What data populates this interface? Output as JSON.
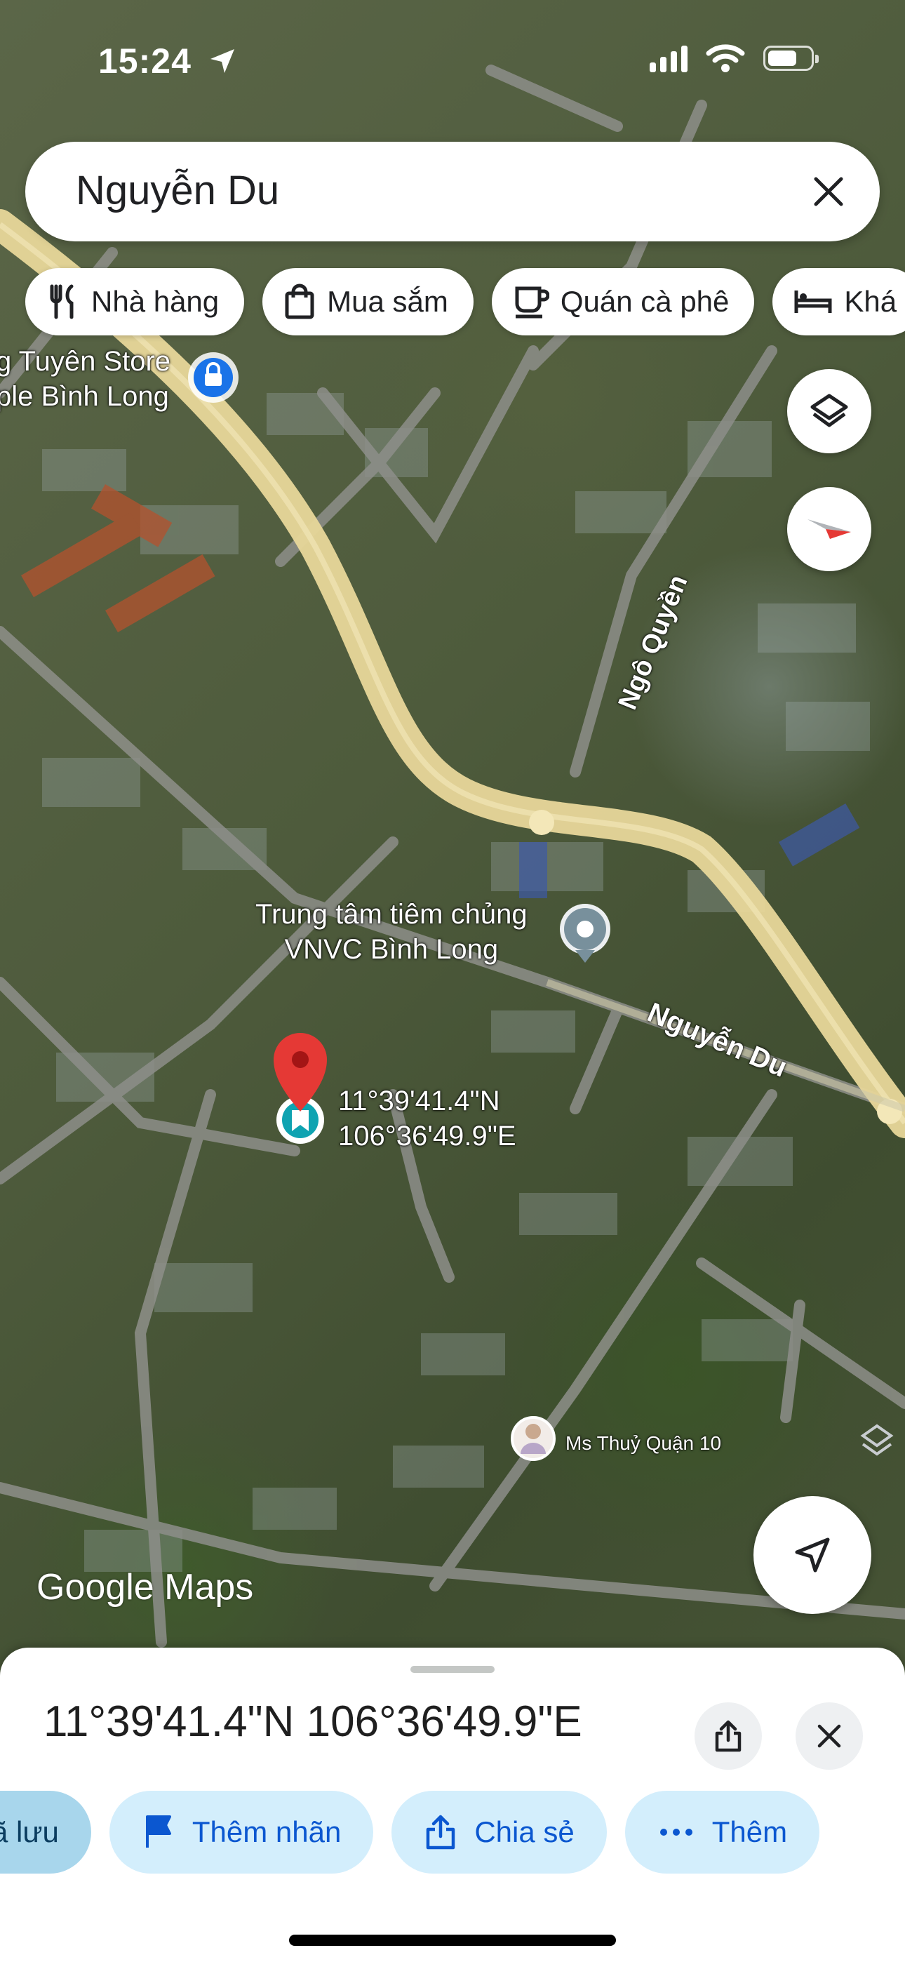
{
  "status_bar": {
    "time": "15:24"
  },
  "search": {
    "query": "Nguyễn Du"
  },
  "chips": [
    {
      "label": "Nhà hàng",
      "icon": "fork-knife-icon"
    },
    {
      "label": "Mua sắm",
      "icon": "shopping-bag-icon"
    },
    {
      "label": "Quán cà phê",
      "icon": "coffee-cup-icon"
    },
    {
      "label": "Khá",
      "icon": "bed-icon"
    }
  ],
  "map": {
    "poi_store_line1": "g Tuyên Store",
    "poi_store_line2": "ple Bình Long",
    "poi_vnvc_line1": "Trung tâm tiêm chủng",
    "poi_vnvc_line2": "VNVC Bình Long",
    "street_ngo_quyen": "Ngô Quyền",
    "street_nguyen_du": "Nguyễn Du",
    "pin_lat": "11°39'41.4\"N",
    "pin_lng": "106°36'49.9\"E",
    "user_label": "Ms Thuỷ Quận 10",
    "brand": "Google Maps"
  },
  "sheet": {
    "title": "11°39'41.4\"N 106°36'49.9\"E",
    "actions": [
      {
        "label": "ã lưu",
        "icon": "bookmark-icon"
      },
      {
        "label": "Thêm nhãn",
        "icon": "flag-icon"
      },
      {
        "label": "Chia sẻ",
        "icon": "share-icon"
      },
      {
        "label": "Thêm",
        "icon": "more-dots-icon"
      }
    ]
  },
  "colors": {
    "accent": "#0b57d0",
    "pin": "#e53935",
    "road": "#e8d79a",
    "chip_bg": "#d3eefc"
  }
}
